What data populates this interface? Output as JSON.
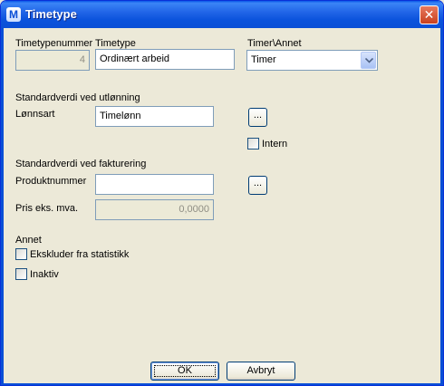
{
  "window": {
    "title": "Timetype",
    "app_icon_letter": "M",
    "close_label": "✕"
  },
  "header_row": {
    "number_label": "Timetypenummer",
    "number_value": "4",
    "name_label": "Timetype",
    "name_value": "Ordinært arbeid",
    "unit_label": "Timer\\Annet",
    "unit_selected": "Timer"
  },
  "payroll": {
    "section_label": "Standardverdi ved utlønning",
    "wage_type_label": "Lønnsart",
    "wage_type_value": "Timelønn",
    "browse_label": "...",
    "intern_label": "Intern",
    "intern_checked": false
  },
  "invoicing": {
    "section_label": "Standardverdi ved fakturering",
    "product_label": "Produktnummer",
    "product_value": "",
    "browse_label": "...",
    "price_label": "Pris eks. mva.",
    "price_value": "0,0000"
  },
  "other": {
    "section_label": "Annet",
    "exclude_label": "Ekskluder fra statistikk",
    "exclude_checked": false,
    "inactive_label": "Inaktiv",
    "inactive_checked": false
  },
  "buttons": {
    "ok_label": "OK",
    "cancel_label": "Avbryt"
  },
  "colors": {
    "titlebar": "#0a4fd6",
    "dialog_bg": "#ece9d8",
    "field_border": "#7f9db9"
  }
}
